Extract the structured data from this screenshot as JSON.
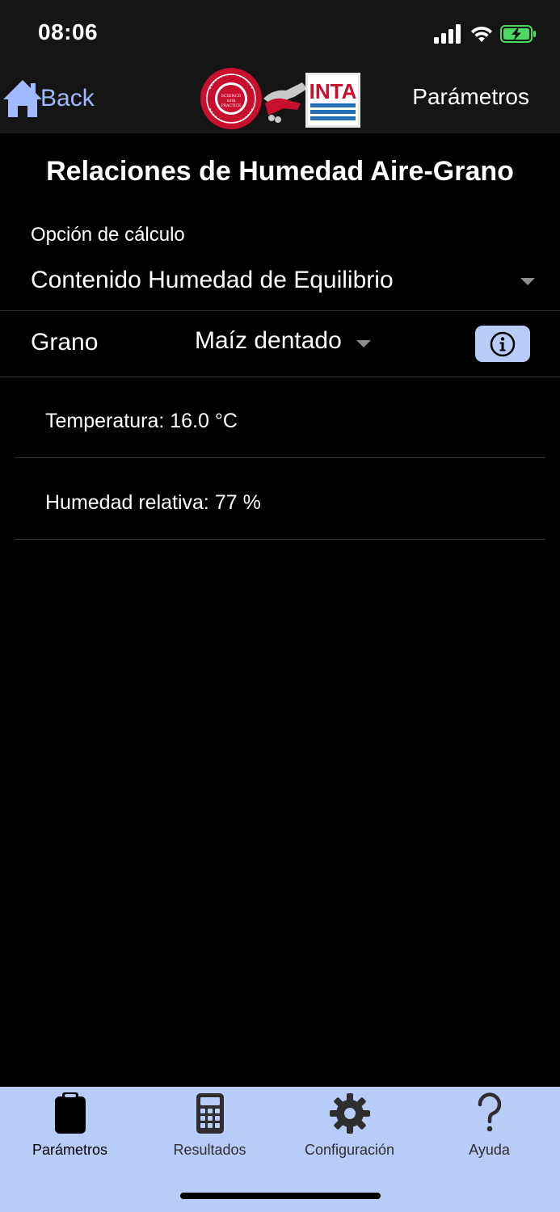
{
  "status_bar": {
    "time": "08:06",
    "signal_icon": "cellular-signal-icon",
    "wifi_icon": "wifi-icon",
    "battery_icon": "battery-charging-icon",
    "battery_color": "#4cd964"
  },
  "nav": {
    "back_label": "Back",
    "back_icon": "home-icon",
    "title": "Parámetros",
    "logos": {
      "left": "Iowa State University seal",
      "left_text": "IOWA STATE UNIVERSITY OF SCIENCE AND TECHNOLOGY",
      "left_motto": "SCIENCE with PRACTICE",
      "center": "handshake-icon",
      "right": "INTA"
    }
  },
  "page": {
    "title": "Relaciones de Humedad Aire-Grano"
  },
  "calc_option": {
    "label": "Opción de cálculo",
    "selected": "Contenido Humedad de Equilibrio"
  },
  "grain": {
    "label": "Grano",
    "selected": "Maíz dentado",
    "info_icon": "info-icon"
  },
  "params": [
    {
      "text": "Temperatura: 16.0 °C"
    },
    {
      "text": "Humedad relativa: 77 %"
    }
  ],
  "tabs": [
    {
      "label": "Parámetros",
      "icon": "clipboard-icon",
      "active": true
    },
    {
      "label": "Resultados",
      "icon": "calculator-icon",
      "active": false
    },
    {
      "label": "Configuración",
      "icon": "gear-icon",
      "active": false
    },
    {
      "label": "Ayuda",
      "icon": "question-mark-icon",
      "active": false
    }
  ],
  "colors": {
    "accent": "#9fb8ff",
    "tab_bar_bg": "#b7ccf6",
    "info_button_bg": "#b7ccf6",
    "isu_red": "#c8102e",
    "inta_blue": "#1f6fb8"
  }
}
